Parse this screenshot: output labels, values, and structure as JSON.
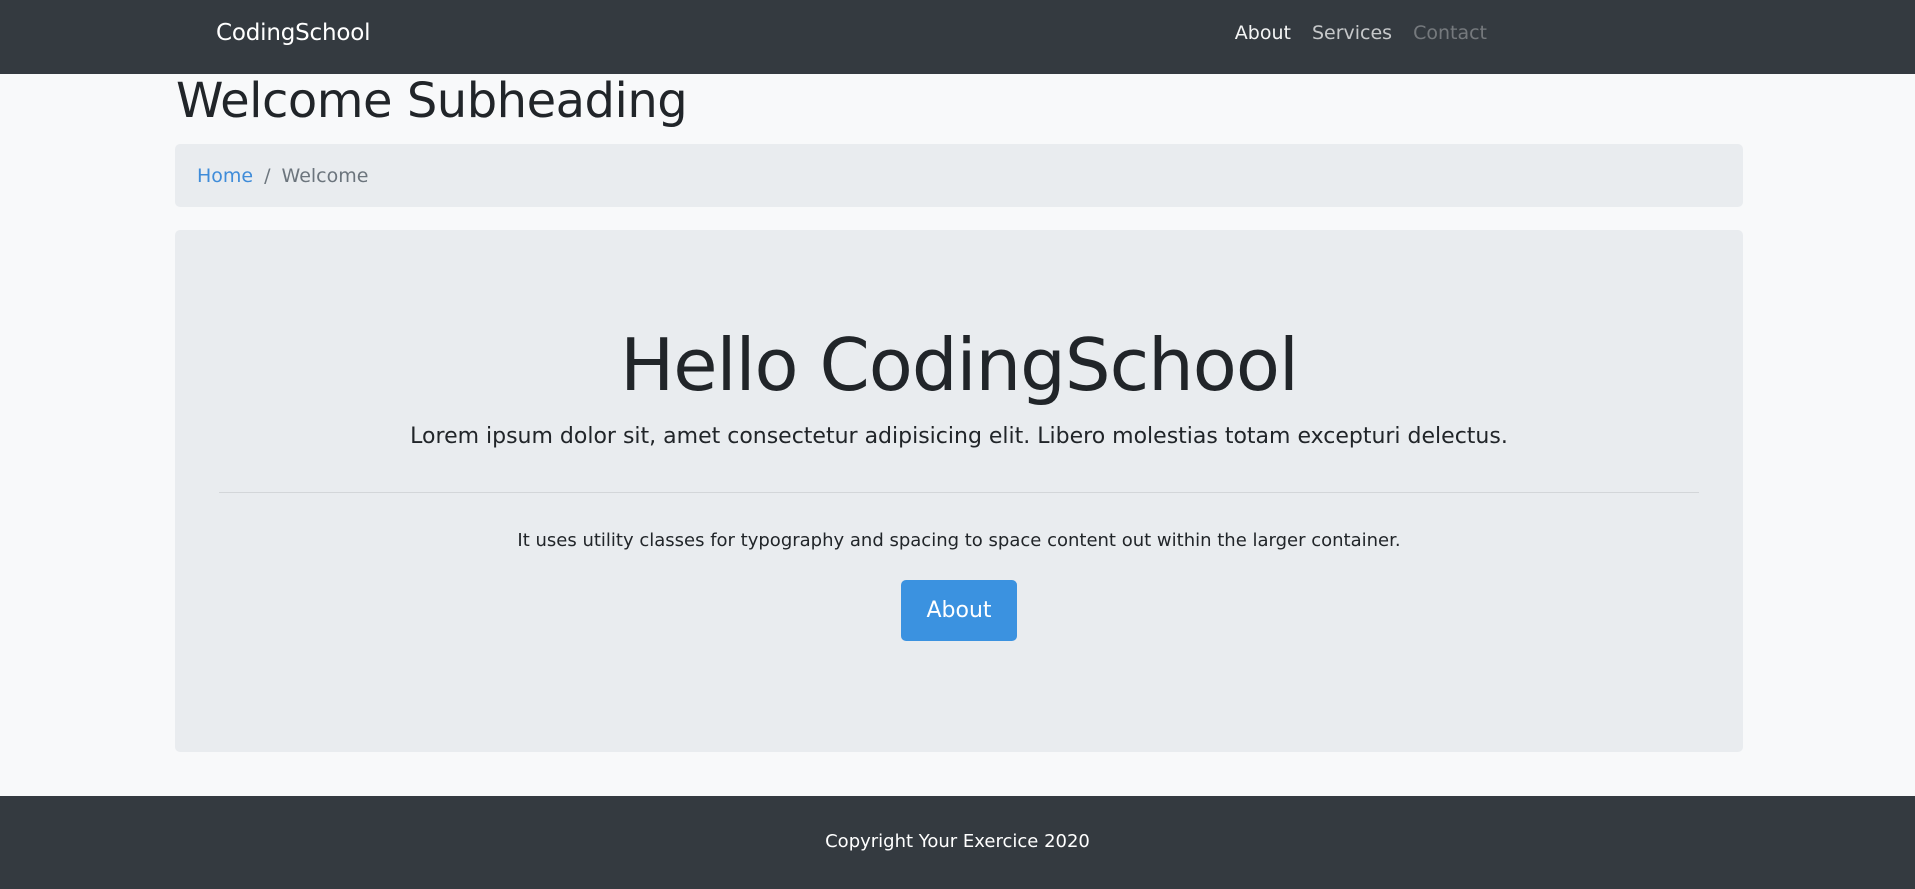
{
  "navbar": {
    "brand": "CodingSchool",
    "links": [
      {
        "label": "About",
        "state": "active"
      },
      {
        "label": "Services",
        "state": "normal"
      },
      {
        "label": "Contact",
        "state": "disabled"
      }
    ]
  },
  "page": {
    "subheading": "Welcome Subheading"
  },
  "breadcrumb": {
    "home": "Home",
    "separator": "/",
    "current": "Welcome"
  },
  "jumbotron": {
    "title": "Hello CodingSchool",
    "lead": "Lorem ipsum dolor sit, amet consectetur adipisicing elit. Libero molestias totam excepturi delectus.",
    "body": "It uses utility classes for typography and spacing to space content out within the larger container.",
    "button_label": "About"
  },
  "footer": {
    "copyright": "Copyright Your Exercice 2020"
  },
  "colors": {
    "navbar_bg": "#343a40",
    "page_bg": "#f8f9fa",
    "panel_bg": "#e9ecef",
    "link": "#3f8cd9",
    "primary_button": "#3b92e0"
  }
}
